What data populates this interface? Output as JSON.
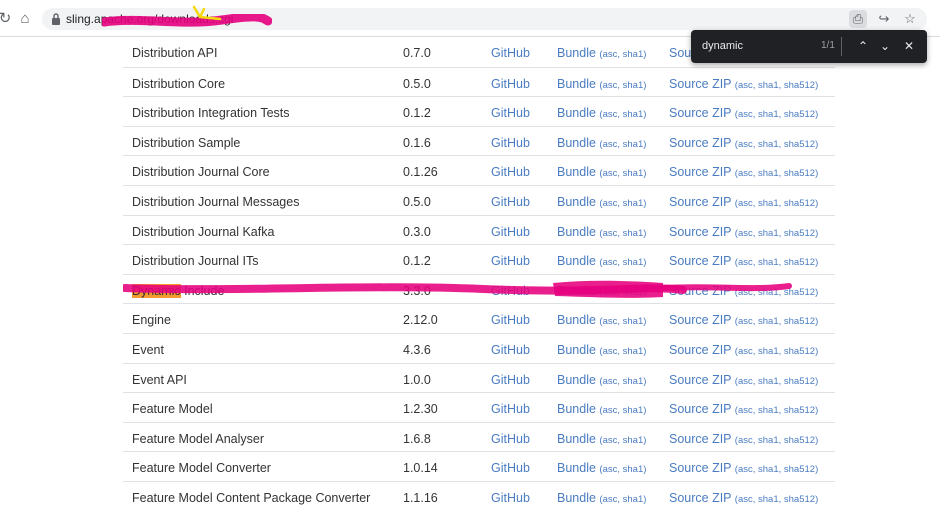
{
  "browser": {
    "url": "sling.apache.org/downloads.cgi",
    "find": {
      "query": "dynamic",
      "count": "1/1"
    }
  },
  "table": {
    "rows": [
      {
        "name": "Distribution API",
        "version": "0.7.0",
        "github": "GitHub",
        "bundle": "Bundle",
        "bundle_sub": "(asc, sha1)",
        "source": "Source",
        "source_sub": ""
      },
      {
        "name": "Distribution Core",
        "version": "0.5.0",
        "github": "GitHub",
        "bundle": "Bundle",
        "bundle_sub": "(asc, sha1)",
        "source": "Source ZIP",
        "source_sub": "(asc, sha1, sha512)"
      },
      {
        "name": "Distribution Integration Tests",
        "version": "0.1.2",
        "github": "GitHub",
        "bundle": "Bundle",
        "bundle_sub": "(asc, sha1)",
        "source": "Source ZIP",
        "source_sub": "(asc, sha1, sha512)"
      },
      {
        "name": "Distribution Sample",
        "version": "0.1.6",
        "github": "GitHub",
        "bundle": "Bundle",
        "bundle_sub": "(asc, sha1)",
        "source": "Source ZIP",
        "source_sub": "(asc, sha1, sha512)"
      },
      {
        "name": "Distribution Journal Core",
        "version": "0.1.26",
        "github": "GitHub",
        "bundle": "Bundle",
        "bundle_sub": "(asc, sha1)",
        "source": "Source ZIP",
        "source_sub": "(asc, sha1, sha512)"
      },
      {
        "name": "Distribution Journal Messages",
        "version": "0.5.0",
        "github": "GitHub",
        "bundle": "Bundle",
        "bundle_sub": "(asc, sha1)",
        "source": "Source ZIP",
        "source_sub": "(asc, sha1, sha512)"
      },
      {
        "name": "Distribution Journal Kafka",
        "version": "0.3.0",
        "github": "GitHub",
        "bundle": "Bundle",
        "bundle_sub": "(asc, sha1)",
        "source": "Source ZIP",
        "source_sub": "(asc, sha1, sha512)"
      },
      {
        "name": "Distribution Journal ITs",
        "version": "0.1.2",
        "github": "GitHub",
        "bundle": "Bundle",
        "bundle_sub": "(asc, sha1)",
        "source": "Source ZIP",
        "source_sub": "(asc, sha1, sha512)"
      },
      {
        "name_highlight": "Dynamic",
        "name_rest": " Include",
        "version": "3.3.0",
        "github": "GitHub",
        "bundle": "Bundle",
        "bundle_sub": "(asc, sha1)",
        "source": "Source ZIP",
        "source_sub": "(asc, sha1, sha512)"
      },
      {
        "name": "Engine",
        "version": "2.12.0",
        "github": "GitHub",
        "bundle": "Bundle",
        "bundle_sub": "(asc, sha1)",
        "source": "Source ZIP",
        "source_sub": "(asc, sha1, sha512)"
      },
      {
        "name": "Event",
        "version": "4.3.6",
        "github": "GitHub",
        "bundle": "Bundle",
        "bundle_sub": "(asc, sha1)",
        "source": "Source ZIP",
        "source_sub": "(asc, sha1, sha512)"
      },
      {
        "name": "Event API",
        "version": "1.0.0",
        "github": "GitHub",
        "bundle": "Bundle",
        "bundle_sub": "(asc, sha1)",
        "source": "Source ZIP",
        "source_sub": "(asc, sha1, sha512)"
      },
      {
        "name": "Feature Model",
        "version": "1.2.30",
        "github": "GitHub",
        "bundle": "Bundle",
        "bundle_sub": "(asc, sha1)",
        "source": "Source ZIP",
        "source_sub": "(asc, sha1, sha512)"
      },
      {
        "name": "Feature Model Analyser",
        "version": "1.6.8",
        "github": "GitHub",
        "bundle": "Bundle",
        "bundle_sub": "(asc, sha1)",
        "source": "Source ZIP",
        "source_sub": "(asc, sha1, sha512)"
      },
      {
        "name": "Feature Model Converter",
        "version": "1.0.14",
        "github": "GitHub",
        "bundle": "Bundle",
        "bundle_sub": "(asc, sha1)",
        "source": "Source ZIP",
        "source_sub": "(asc, sha1, sha512)"
      },
      {
        "name": "Feature Model Content Package Converter",
        "version": "1.1.16",
        "github": "GitHub",
        "bundle": "Bundle",
        "bundle_sub": "(asc, sha1)",
        "source": "Source ZIP",
        "source_sub": "(asc, sha1, sha512)"
      }
    ]
  },
  "colors": {
    "link": "#4a7cc2",
    "highlight": "#f29b2e",
    "annotation": "#e6007e",
    "arrow": "#f5d90a"
  },
  "icons": [
    "reload-icon",
    "home-icon",
    "lock-icon",
    "save-page-icon",
    "share-icon",
    "star-icon",
    "chevron-up-icon",
    "chevron-down-icon",
    "close-icon"
  ]
}
